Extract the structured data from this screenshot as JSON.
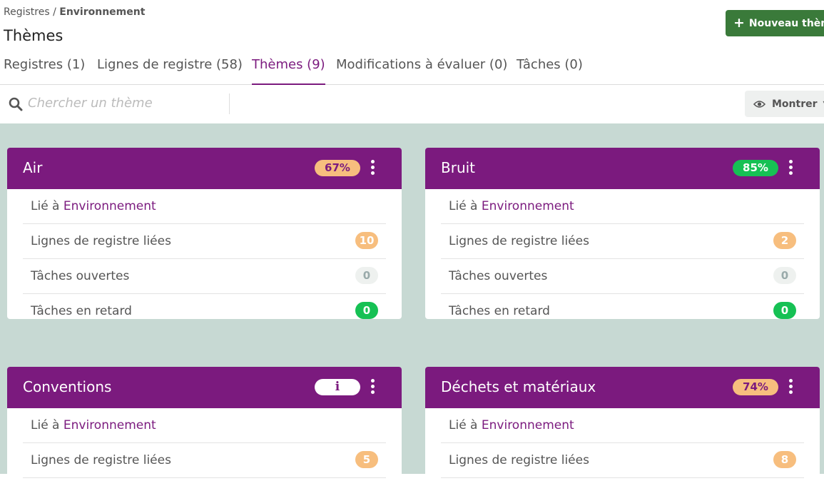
{
  "breadcrumb": {
    "parent": "Registres",
    "separator": " / ",
    "current": "Environnement"
  },
  "page_title": "Thèmes",
  "new_button": {
    "label": "Nouveau thème"
  },
  "tabs": [
    {
      "label": "Registres (1)"
    },
    {
      "label": "Lignes de registre (58)"
    },
    {
      "label": "Thèmes (9)",
      "active": true
    },
    {
      "label": "Modifications à évaluer (0)"
    },
    {
      "label": "Tâches (0)"
    }
  ],
  "search": {
    "placeholder": "Chercher un thème"
  },
  "show_button": {
    "label": "Montrer"
  },
  "colors": {
    "accent": "#7b1a7e",
    "primary_button": "#3a7a3a",
    "background": "#c7d9d3",
    "green": "#16c154",
    "orange": "#f7be7e"
  },
  "labels": {
    "linked_to": "Lié à ",
    "register_lines": "Lignes de registre liées",
    "open_tasks": "Tâches ouvertes",
    "late_tasks": "Tâches en retard"
  },
  "cards": [
    {
      "title": "Air",
      "badge": "67%",
      "linked": "Environnement",
      "register_lines": "10",
      "open_tasks": "0",
      "late_tasks": "0"
    },
    {
      "title": "Bruit",
      "badge": "85%",
      "linked": "Environnement",
      "register_lines": "2",
      "open_tasks": "0",
      "late_tasks": "0"
    },
    {
      "title": "Conventions",
      "badge": "i",
      "linked": "Environnement",
      "register_lines": "5"
    },
    {
      "title": "Déchets et matériaux",
      "badge": "74%",
      "linked": "Environnement",
      "register_lines": "8"
    }
  ]
}
